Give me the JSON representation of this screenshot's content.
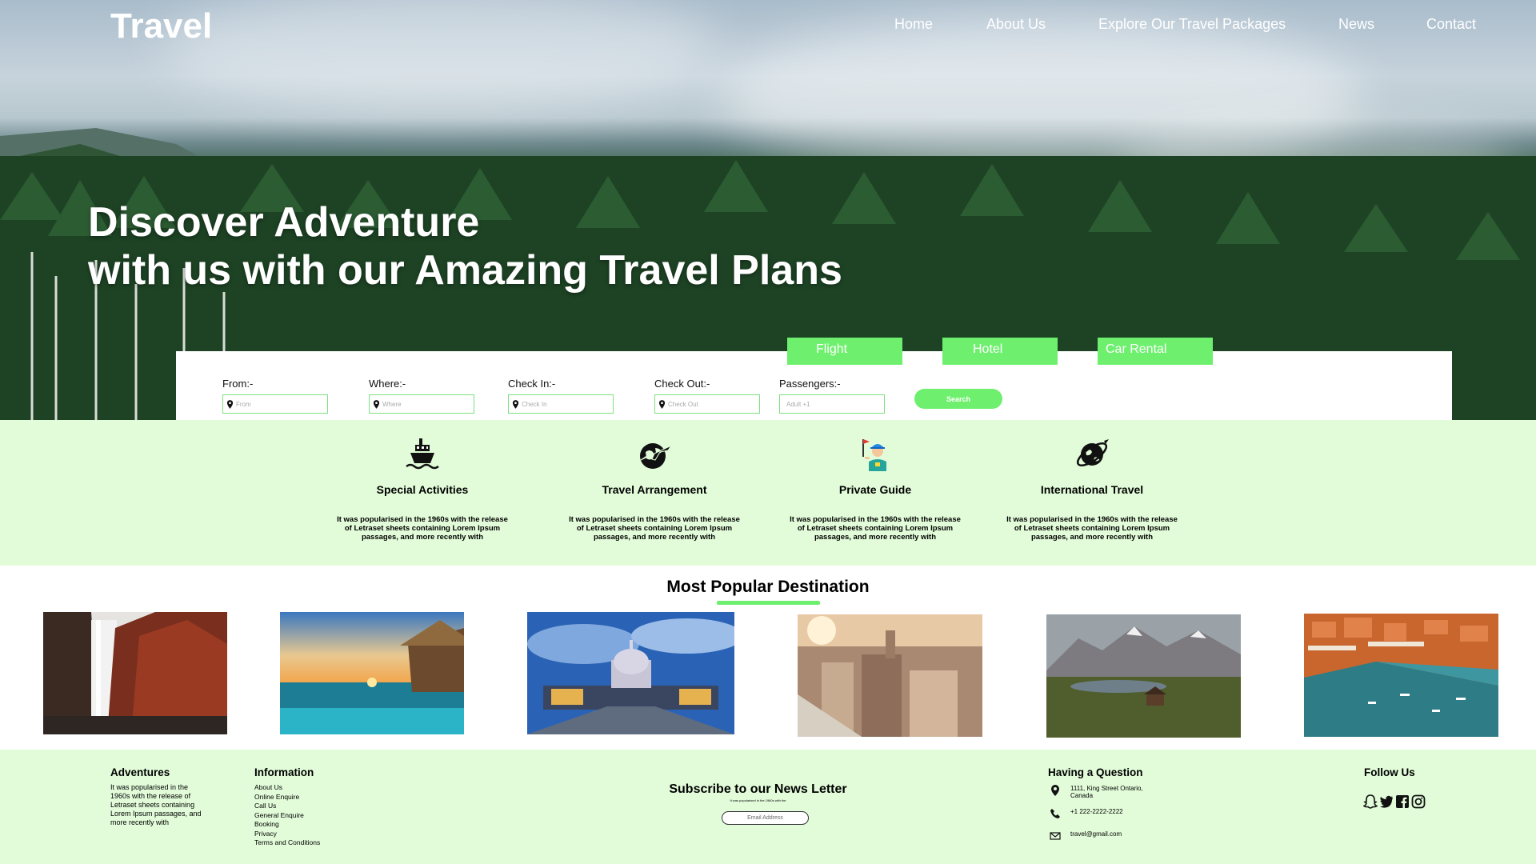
{
  "brand": {
    "logo": "Travel",
    "accent": "#6ef06e",
    "light_bg": "#e2fcd9"
  },
  "nav": {
    "items": [
      "Home",
      "About Us",
      "Explore Our Travel Packages",
      "News",
      "Contact"
    ]
  },
  "hero": {
    "line1": "Discover Adventure",
    "line2": "with us with our Amazing Travel Plans"
  },
  "search": {
    "tabs": [
      "Flight",
      "Hotel",
      "Car Rental"
    ],
    "fields": [
      {
        "label": "From:-",
        "placeholder": "From"
      },
      {
        "label": "Where:-",
        "placeholder": "Where"
      },
      {
        "label": "Check In:-",
        "placeholder": "Check In"
      },
      {
        "label": "Check Out:-",
        "placeholder": "Check Out"
      },
      {
        "label": "Passengers:-",
        "placeholder": "Adult +1"
      }
    ],
    "button": "Search",
    "field_icon": "map-pin-icon"
  },
  "services": [
    {
      "icon": "ship-icon",
      "title": "Special Activities",
      "desc": "It was popularised in the 1960s with the release of Letraset sheets containing Lorem Ipsum passages, and more recently with"
    },
    {
      "icon": "plane-globe-icon",
      "title": "Travel Arrangement",
      "desc": "It was popularised in the 1960s with the release of Letraset sheets containing Lorem Ipsum passages, and more recently with"
    },
    {
      "icon": "tour-guide-icon",
      "title": "Private Guide",
      "desc": "It was popularised in the 1960s with the release of Letraset sheets containing Lorem Ipsum passages, and more recently with"
    },
    {
      "icon": "globe-orbit-icon",
      "title": "International Travel",
      "desc": "It was popularised in the 1960s with the release of Letraset sheets containing Lorem Ipsum passages, and more recently with"
    }
  ],
  "destinations": {
    "title": "Most Popular Destination",
    "images": [
      "waterfall",
      "overwater-bungalow",
      "capitol-building",
      "city-rooftops",
      "mountain-valley",
      "harbor-aerial"
    ]
  },
  "footer": {
    "adventures": {
      "title": "Adventures",
      "text": "It was popularised in the 1960s with the release of Letraset sheets containing Lorem Ipsum passages, and more recently with"
    },
    "information": {
      "title": "Information",
      "links": [
        "About Us",
        "Online Enquire",
        "Call Us",
        "General Enquire",
        "Booking",
        "Privacy",
        "Terms and Conditions"
      ]
    },
    "newsletter": {
      "title": "Subscribe to our News Letter",
      "small": "It was popularised in the 1960s with the",
      "placeholder": "Email Address"
    },
    "question": {
      "title": "Having a Question",
      "address_line1": "1111, King Street Ontario,",
      "address_line2": "Canada",
      "phone": "+1 222-2222-2222",
      "email": "travel@gmail.com"
    },
    "follow": {
      "title": "Follow Us",
      "icons": [
        "snapchat-icon",
        "twitter-icon",
        "facebook-icon",
        "instagram-icon"
      ]
    }
  }
}
